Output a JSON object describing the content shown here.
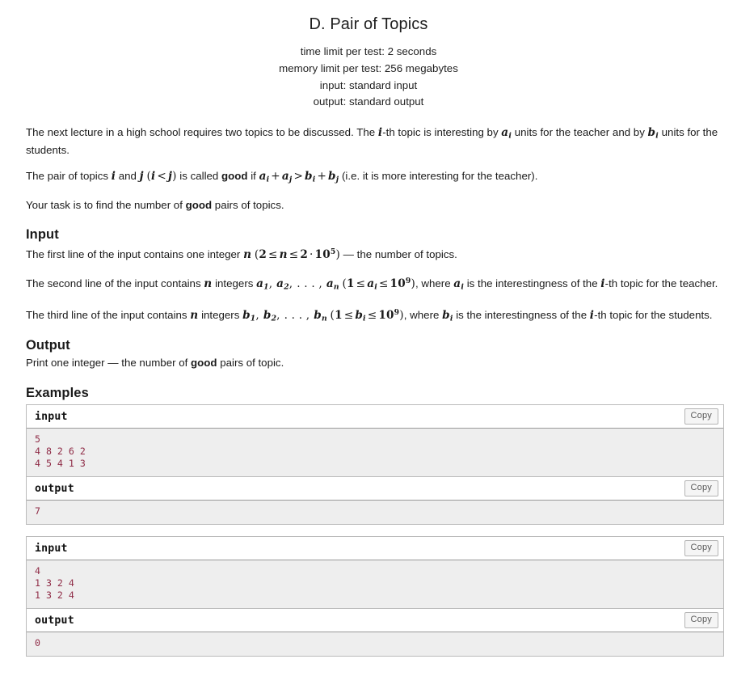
{
  "header": {
    "title": "D. Pair of Topics",
    "limits": [
      "time limit per test: 2 seconds",
      "memory limit per test: 256 megabytes",
      "input: standard input",
      "output: standard output"
    ]
  },
  "statement": {
    "p1_a": "The next lecture in a high school requires two topics to be discussed. The ",
    "p1_i": "i",
    "p1_b": "-th topic is interesting by ",
    "p1_ai": "a",
    "p1_ai_sub": "i",
    "p1_c": " units for the teacher and by ",
    "p1_bi": "b",
    "p1_bi_sub": "i",
    "p1_d": " units for the students.",
    "p2_a": "The pair of topics ",
    "p2_i": "i",
    "p2_and": " and ",
    "p2_j": "j",
    "p2_cond_open": "(",
    "p2_cond_i": "i",
    "p2_cond_lt": "<",
    "p2_cond_j": "j",
    "p2_cond_close": ")",
    "p2_b": " is called ",
    "p2_good": "good",
    "p2_c": " if ",
    "p2_eq_ai": "a",
    "p2_eq_ai_sub": "i",
    "p2_eq_plus": "+",
    "p2_eq_aj": "a",
    "p2_eq_aj_sub": "j",
    "p2_eq_gt": ">",
    "p2_eq_bi": "b",
    "p2_eq_bi_sub": "i",
    "p2_eq_plus2": "+",
    "p2_eq_bj": "b",
    "p2_eq_bj_sub": "j",
    "p2_d": " (i.e. it is more interesting for the teacher).",
    "p3_a": "Your task is to find the number of ",
    "p3_good": "good",
    "p3_b": " pairs of topics."
  },
  "input_section": {
    "heading": "Input",
    "p1_a": "The first line of the input contains one integer ",
    "p1_n": "n",
    "p1_open": "(",
    "p1_two": "2",
    "p1_le1": "≤",
    "p1_n2": "n",
    "p1_le2": "≤",
    "p1_two2": "2",
    "p1_cdot": "·",
    "p1_ten": "10",
    "p1_exp": "5",
    "p1_close": ")",
    "p1_b": " — the number of topics.",
    "p2_a": "The second line of the input contains ",
    "p2_n": "n",
    "p2_b": " integers ",
    "p2_a1": "a",
    "p2_a1_sub": "1",
    "p2_comma1": ",",
    "p2_a2": "a",
    "p2_a2_sub": "2",
    "p2_comma2": ",",
    "p2_dots": ". . . ,",
    "p2_an": "a",
    "p2_an_sub": "n",
    "p2_open": "(",
    "p2_one": "1",
    "p2_le1": "≤",
    "p2_ai": "a",
    "p2_ai_sub": "i",
    "p2_le2": "≤",
    "p2_ten": "10",
    "p2_exp": "9",
    "p2_close": ")",
    "p2_c": ", where ",
    "p2_ai2": "a",
    "p2_ai2_sub": "i",
    "p2_d": " is the interestingness of the ",
    "p2_i": "i",
    "p2_e": "-th topic for the teacher.",
    "p3_a": "The third line of the input contains ",
    "p3_n": "n",
    "p3_b": " integers ",
    "p3_b1": "b",
    "p3_b1_sub": "1",
    "p3_comma1": ",",
    "p3_b2": "b",
    "p3_b2_sub": "2",
    "p3_comma2": ",",
    "p3_dots": ". . . ,",
    "p3_bn": "b",
    "p3_bn_sub": "n",
    "p3_open": "(",
    "p3_one": "1",
    "p3_le1": "≤",
    "p3_bi": "b",
    "p3_bi_sub": "i",
    "p3_le2": "≤",
    "p3_ten": "10",
    "p3_exp": "9",
    "p3_close": ")",
    "p3_c": ", where ",
    "p3_bi2": "b",
    "p3_bi2_sub": "i",
    "p3_d": " is the interestingness of the ",
    "p3_i": "i",
    "p3_e": "-th topic for the students."
  },
  "output_section": {
    "heading": "Output",
    "p1_a": "Print one integer — the number of ",
    "p1_good": "good",
    "p1_b": " pairs of topic."
  },
  "examples": {
    "heading": "Examples",
    "copy_label": "Copy",
    "input_label": "input",
    "output_label": "output",
    "tests": [
      {
        "input": "5\n4 8 2 6 2\n4 5 4 1 3",
        "output": "7"
      },
      {
        "input": "4\n1 3 2 4\n1 3 2 4",
        "output": "0"
      }
    ]
  },
  "colors": {
    "test_text": "#8f2b46",
    "test_bg": "#eeeeee",
    "border": "#bbbbbb"
  }
}
